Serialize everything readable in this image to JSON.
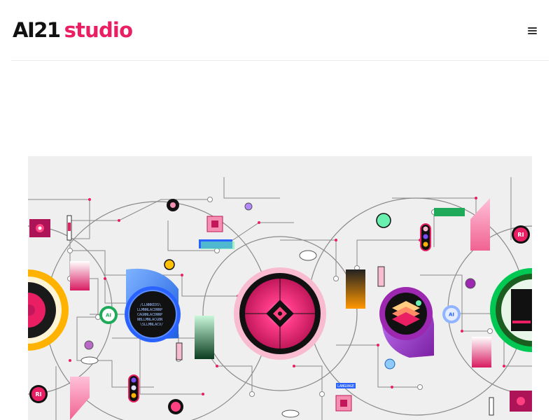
{
  "brand": {
    "name_part1": "AI21",
    "name_part2": "studio",
    "accent": "#e91e63"
  },
  "header": {
    "menu_icon": "hamburger-menu-icon"
  },
  "hero": {
    "labels": {
      "ai_left": "AI",
      "ai_right": "AI",
      "language": "LANGUAGE",
      "ri_top": "RI",
      "ri_bottom": "RI"
    }
  }
}
